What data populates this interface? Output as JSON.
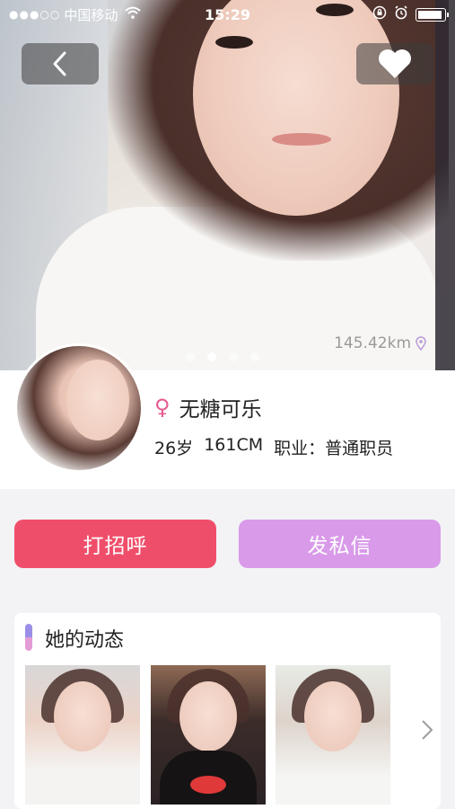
{
  "status_bar": {
    "signal": "●●●○○",
    "carrier": "中国移动",
    "wifi": "wifi-icon",
    "time": "15:29",
    "icons": [
      "lock-rotation-icon",
      "alarm-icon",
      "battery-icon"
    ]
  },
  "hero": {
    "distance": "145.42km",
    "carousel": {
      "count": 4,
      "active_index": 1
    }
  },
  "profile": {
    "gender_icon": "female-icon",
    "name": "无糖可乐",
    "age": "26岁",
    "height": "161CM",
    "job": "职业：普通职员"
  },
  "actions": {
    "greet_label": "打招呼",
    "message_label": "发私信"
  },
  "moments": {
    "title": "她的动态",
    "thumbnails": 3
  },
  "colors": {
    "greet": "#ef4e6a",
    "message": "#d99aea",
    "female": "#e55b8f"
  }
}
